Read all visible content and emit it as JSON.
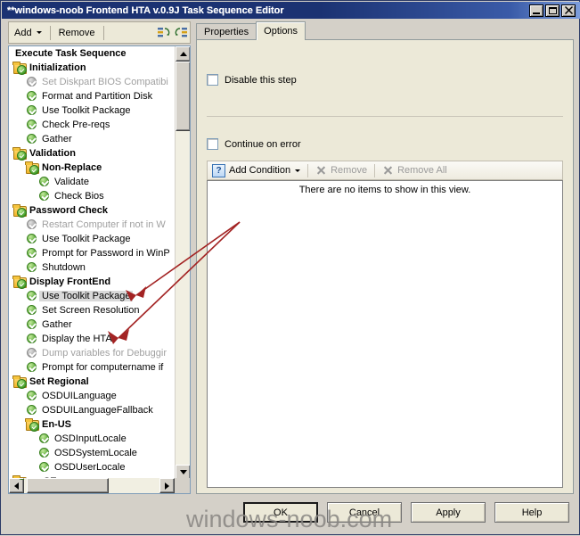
{
  "window": {
    "title": "**windows-noob Frontend HTA v.0.9J Task Sequence Editor",
    "minimize_label": "_",
    "maximize_label": "□",
    "close_label": "✕"
  },
  "toolbar": {
    "add_label": "Add",
    "remove_label": "Remove",
    "icon_collapse_name": "collapse-all-icon",
    "icon_expand_name": "expand-all-icon"
  },
  "tree": {
    "items": [
      {
        "label": "Execute Task Sequence",
        "indent": 0,
        "type": "root",
        "state": "normal"
      },
      {
        "label": "Initialization",
        "indent": 0,
        "type": "folder",
        "state": "normal"
      },
      {
        "label": "Set Diskpart BIOS Compatibi",
        "indent": 1,
        "type": "step",
        "state": "disabled"
      },
      {
        "label": "Format and Partition Disk",
        "indent": 1,
        "type": "step",
        "state": "normal"
      },
      {
        "label": "Use Toolkit Package",
        "indent": 1,
        "type": "step",
        "state": "normal"
      },
      {
        "label": "Check Pre-reqs",
        "indent": 1,
        "type": "step",
        "state": "normal"
      },
      {
        "label": "Gather",
        "indent": 1,
        "type": "step",
        "state": "normal"
      },
      {
        "label": "Validation",
        "indent": 0,
        "type": "folder",
        "state": "normal"
      },
      {
        "label": "Non-Replace",
        "indent": 1,
        "type": "folder",
        "state": "normal"
      },
      {
        "label": "Validate",
        "indent": 2,
        "type": "step",
        "state": "normal"
      },
      {
        "label": "Check Bios",
        "indent": 2,
        "type": "step",
        "state": "normal"
      },
      {
        "label": "Password Check",
        "indent": 0,
        "type": "folder",
        "state": "normal"
      },
      {
        "label": "Restart Computer if not in W",
        "indent": 1,
        "type": "step",
        "state": "disabled"
      },
      {
        "label": "Use Toolkit Package",
        "indent": 1,
        "type": "step",
        "state": "normal"
      },
      {
        "label": "Prompt for Password in WinP",
        "indent": 1,
        "type": "step",
        "state": "normal"
      },
      {
        "label": "Shutdown",
        "indent": 1,
        "type": "step",
        "state": "normal"
      },
      {
        "label": "Display FrontEnd",
        "indent": 0,
        "type": "folder",
        "state": "normal"
      },
      {
        "label": "Use Toolkit Package",
        "indent": 1,
        "type": "step",
        "state": "selected"
      },
      {
        "label": "Set Screen Resolution",
        "indent": 1,
        "type": "step",
        "state": "normal"
      },
      {
        "label": "Gather",
        "indent": 1,
        "type": "step",
        "state": "normal"
      },
      {
        "label": "Display the HTA",
        "indent": 1,
        "type": "step",
        "state": "normal"
      },
      {
        "label": "Dump variables for Debuggir",
        "indent": 1,
        "type": "step",
        "state": "disabled"
      },
      {
        "label": "Prompt for computername if",
        "indent": 1,
        "type": "step",
        "state": "normal"
      },
      {
        "label": "Set Regional",
        "indent": 0,
        "type": "folder",
        "state": "normal"
      },
      {
        "label": "OSDUILanguage",
        "indent": 1,
        "type": "step",
        "state": "normal"
      },
      {
        "label": "OSDUILanguageFallback",
        "indent": 1,
        "type": "step",
        "state": "normal"
      },
      {
        "label": "En-US",
        "indent": 1,
        "type": "folder",
        "state": "normal"
      },
      {
        "label": "OSDInputLocale",
        "indent": 2,
        "type": "step",
        "state": "normal"
      },
      {
        "label": "OSDSystemLocale",
        "indent": 2,
        "type": "step",
        "state": "normal"
      },
      {
        "label": "OSDUserLocale",
        "indent": 2,
        "type": "step",
        "state": "normal"
      },
      {
        "label": "sv-SE",
        "indent": 0,
        "type": "folder",
        "state": "normal"
      }
    ]
  },
  "tabs": [
    {
      "label": "Properties",
      "active": false
    },
    {
      "label": "Options",
      "active": true
    }
  ],
  "options": {
    "disable_step_label": "Disable this step",
    "disable_step_checked": false,
    "continue_on_error_label": "Continue on error",
    "continue_on_error_checked": false,
    "add_condition_label": "Add Condition",
    "remove_label": "Remove",
    "remove_all_label": "Remove All",
    "empty_list_message": "There are no items to show in this view.",
    "help_icon_glyph": "?"
  },
  "buttons": {
    "ok": "OK",
    "cancel": "Cancel",
    "apply": "Apply",
    "help": "Help"
  },
  "watermark": "windows-noob.com",
  "colors": {
    "title_start": "#1b3272",
    "title_end": "#7c9ddb",
    "face": "#d4d0c8",
    "panel": "#ece9d8",
    "annotation_red": "#a32323",
    "check_green": "#4a9e2a"
  },
  "annotations": [
    {
      "name": "arrow-to-use-toolkit-package"
    },
    {
      "name": "arrow-to-display-the-hta"
    }
  ]
}
